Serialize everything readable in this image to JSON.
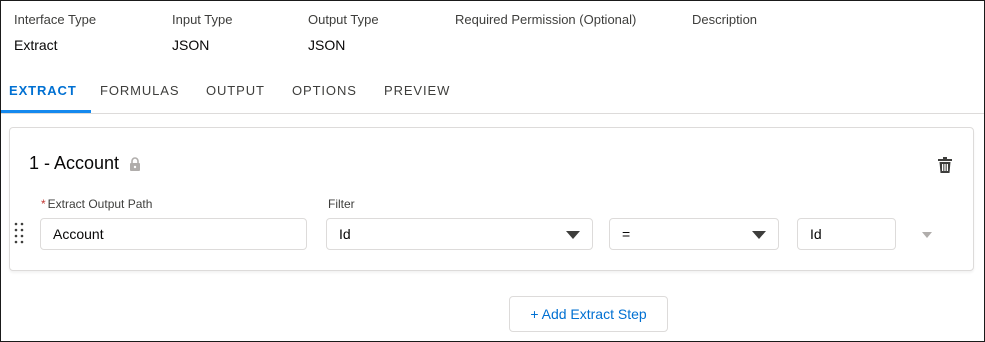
{
  "header": {
    "fields": [
      {
        "label": "Interface Type",
        "value": "Extract"
      },
      {
        "label": "Input Type",
        "value": "JSON"
      },
      {
        "label": "Output Type",
        "value": "JSON"
      },
      {
        "label": "Required Permission (Optional)",
        "value": ""
      },
      {
        "label": "Description",
        "value": ""
      }
    ]
  },
  "tabs": [
    {
      "label": "EXTRACT",
      "active": true
    },
    {
      "label": "FORMULAS",
      "active": false
    },
    {
      "label": "OUTPUT",
      "active": false
    },
    {
      "label": "OPTIONS",
      "active": false
    },
    {
      "label": "PREVIEW",
      "active": false
    }
  ],
  "step": {
    "title": "1 - Account",
    "required_marker": "*",
    "output_path_label": "Extract Output Path",
    "output_path_value": "Account",
    "filter_label": "Filter",
    "filter_field": "Id",
    "filter_operator": "=",
    "filter_value": "Id"
  },
  "add_step_label": "+ Add Extract Step",
  "colors": {
    "accent": "#0070d2",
    "tab_underline": "#1589ee",
    "required": "#c23934",
    "border": "#dddbda"
  },
  "icons": [
    "lock-icon",
    "trash-icon",
    "drag-handle-icon",
    "chevron-down-icon"
  ]
}
